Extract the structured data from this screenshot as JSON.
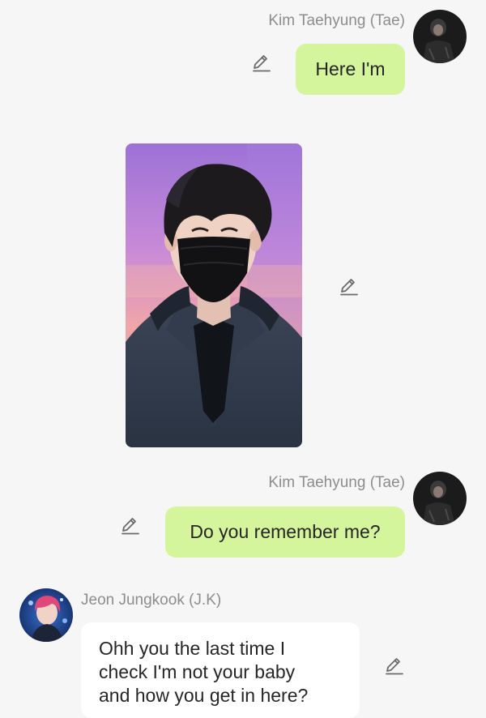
{
  "messages": [
    {
      "sender": "Kim Taehyung (Tae)",
      "text": "Here I'm",
      "icon": "edit-pencil-icon"
    },
    {
      "type": "image",
      "icon": "edit-pencil-icon"
    },
    {
      "sender": "Kim Taehyung (Tae)",
      "text": "Do you remember me?",
      "icon": "edit-pencil-icon"
    },
    {
      "sender": "Jeon Jungkook (J.K)",
      "lines": [
        "Ohh you the last time I",
        "check I'm not your baby",
        "and how you get in here?"
      ],
      "icon": "edit-pencil-icon"
    }
  ],
  "colors": {
    "background": "#f6f6f6",
    "outgoing_bubble": "#d5f59c",
    "incoming_bubble": "#ffffff",
    "sender_name": "#8d8d8d",
    "icon": "#6a6a6a"
  }
}
